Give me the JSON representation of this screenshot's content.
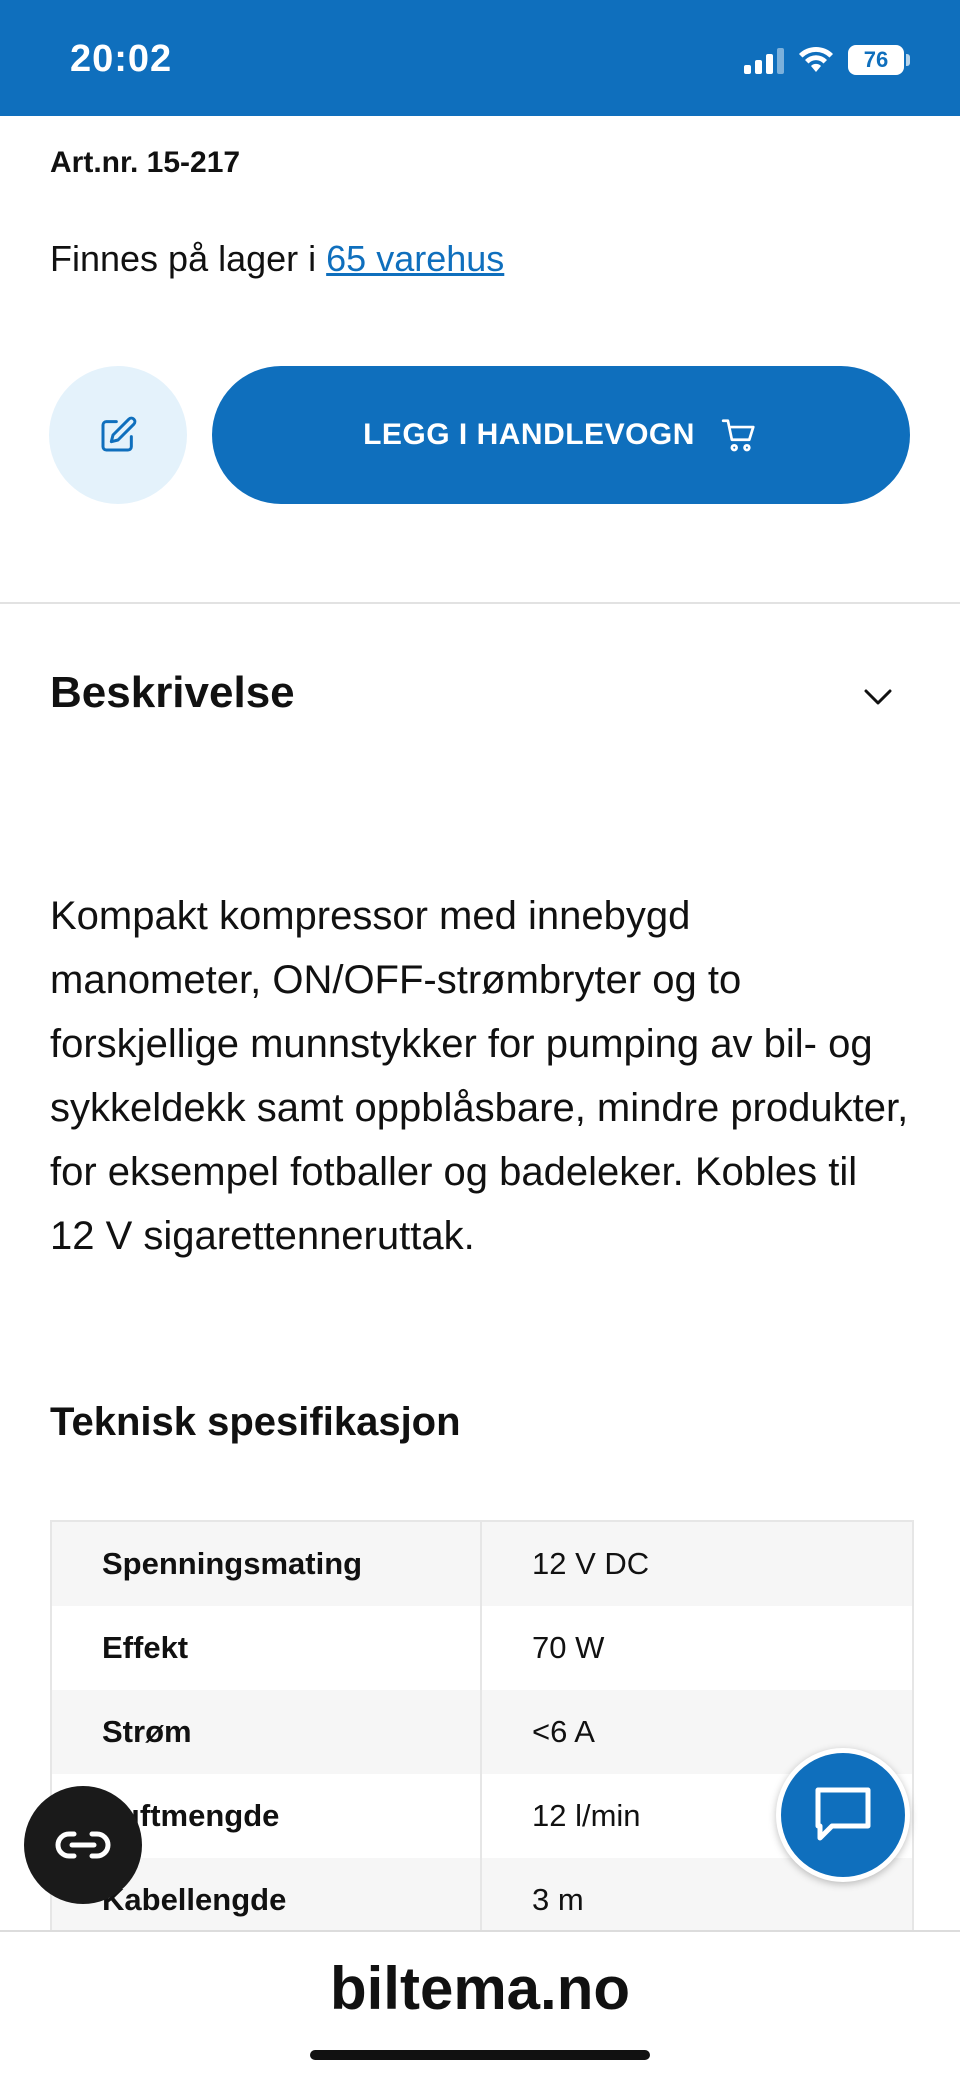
{
  "status_bar": {
    "time": "20:02",
    "battery": "76"
  },
  "product": {
    "art_nr": "Art.nr. 15-217",
    "stock_prefix": "Finnes på lager i ",
    "stock_link": "65 varehus",
    "add_to_cart_label": "LEGG I HANDLEVOGN"
  },
  "description": {
    "heading": "Beskrivelse",
    "body": "Kompakt kompressor med innebygd manometer, ON/OFF-strømbryter og to forskjellige munnstykker for pumping av bil- og sykkeldekk samt oppblåsbare, mindre produkter, for eksempel fotballer og badeleker. Kobles til 12 V sigarettenneruttak."
  },
  "specs": {
    "heading": "Teknisk spesifikasjon",
    "rows": [
      {
        "key": "Spenningsmating",
        "value": "12 V DC"
      },
      {
        "key": "Effekt",
        "value": "70 W"
      },
      {
        "key": "Strøm",
        "value": "<6 A"
      },
      {
        "key": "Luftmengde",
        "value": "12 l/min"
      },
      {
        "key": "Kabellengde",
        "value": "3 m"
      }
    ]
  },
  "browser": {
    "domain": "biltema.no"
  },
  "colors": {
    "brand_blue": "#0f6fbd",
    "light_blue": "#e4f2fb"
  }
}
